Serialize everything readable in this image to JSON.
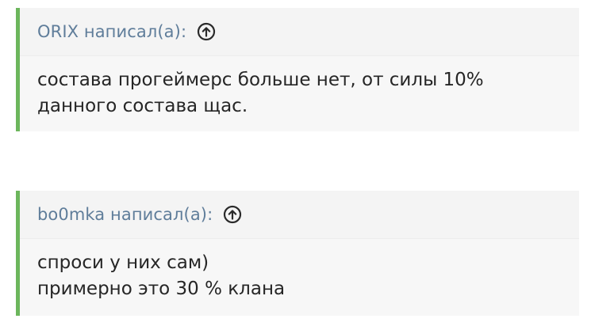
{
  "quotes": [
    {
      "author": "ORIX написал(а):",
      "lines": [
        "состава прогеймерс больше нет, от силы 10%",
        "данного состава щас."
      ]
    },
    {
      "author": "bo0mka написал(а):",
      "lines": [
        "спроси у них сам)",
        "примерно это 30 % клана"
      ]
    }
  ],
  "colors": {
    "accent_border": "#6cb65c",
    "author_text": "#5f7d9a",
    "body_text": "#262626",
    "quote_background": "#f7f7f7"
  },
  "icons": {
    "jump_to_post": "arrow-up-circle-icon"
  }
}
